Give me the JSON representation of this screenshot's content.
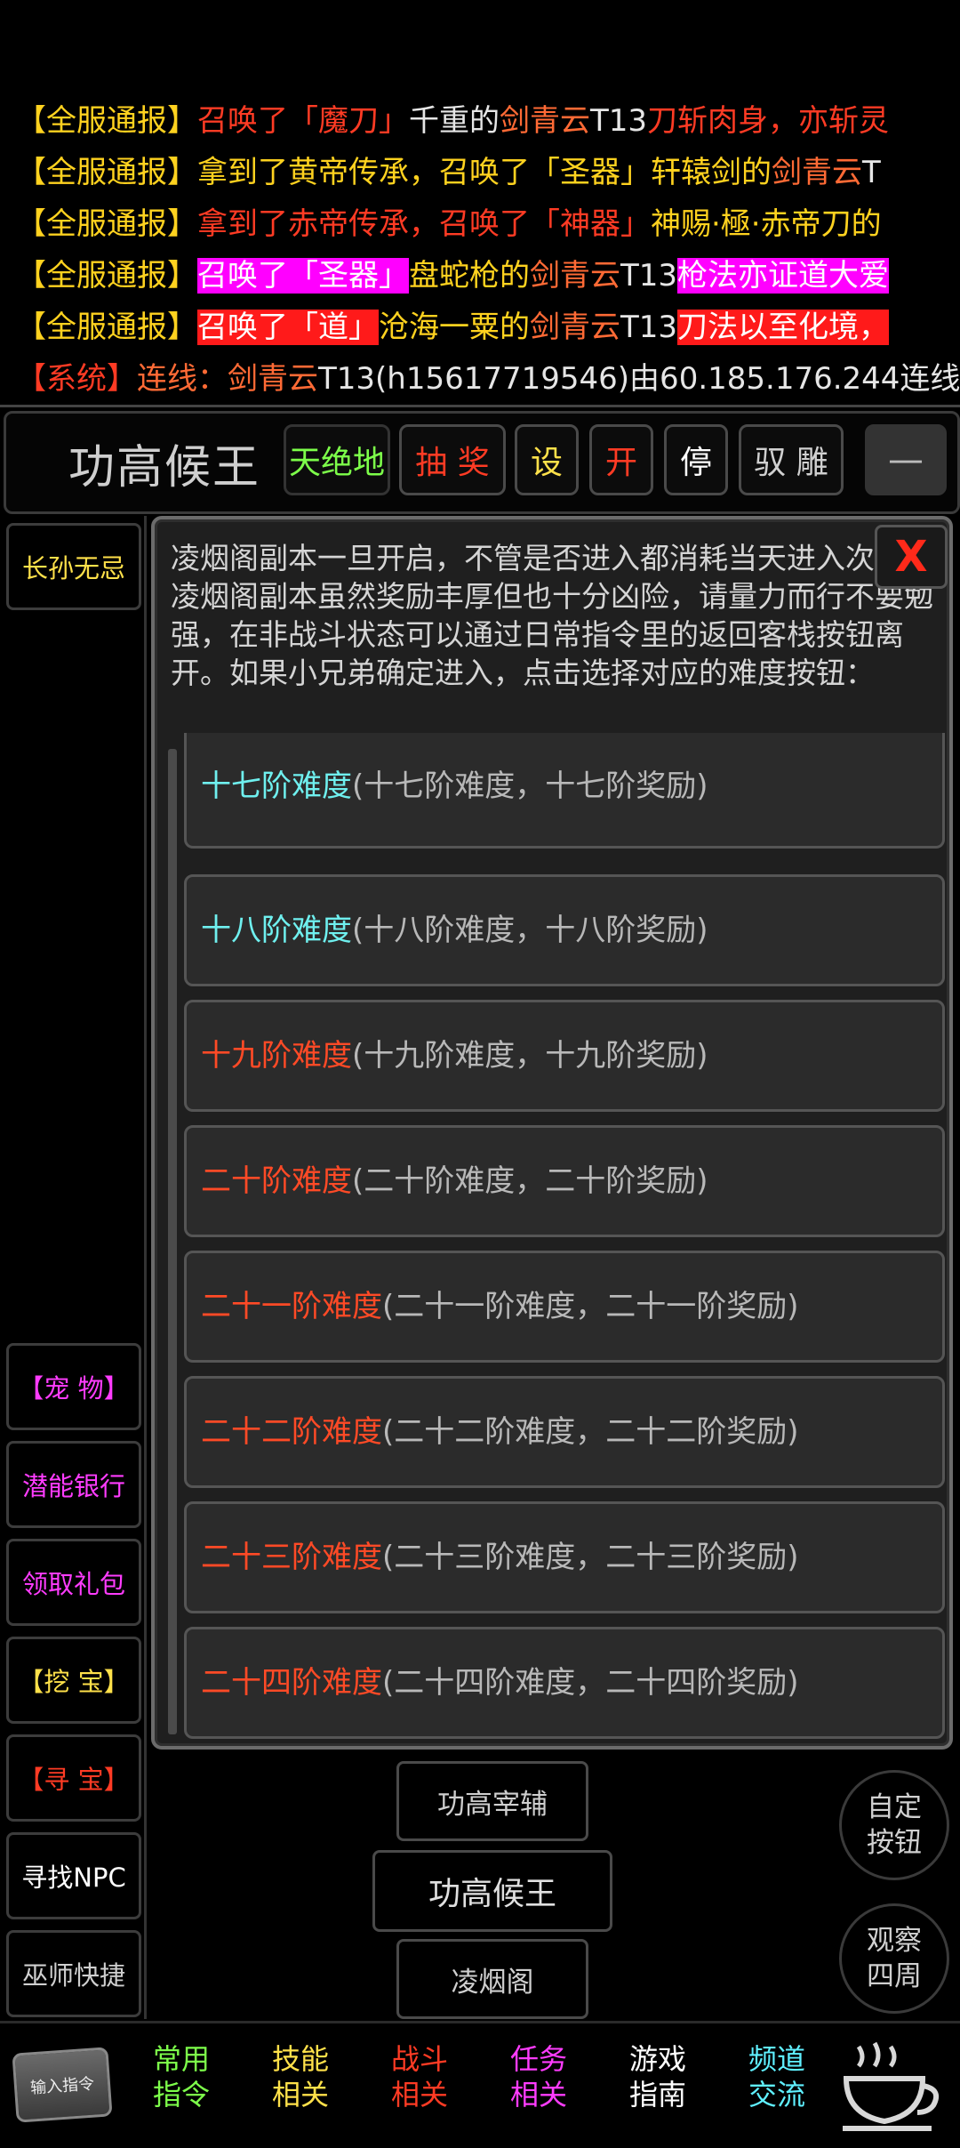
{
  "broadcast": [
    {
      "segments": [
        {
          "t": "【全服通报】",
          "c": "y"
        },
        {
          "t": "召唤了「魔刀」",
          "c": "r"
        },
        {
          "t": "千重",
          "c": "w"
        },
        {
          "t": "的",
          "c": "w"
        },
        {
          "t": "剑青云",
          "c": "o"
        },
        {
          "t": "T13",
          "c": "w"
        },
        {
          "t": "刀斩肉身，亦斩灵",
          "c": "r"
        }
      ]
    },
    {
      "segments": [
        {
          "t": "【全服通报】",
          "c": "y"
        },
        {
          "t": "拿到了黄帝传承，召唤了「圣器」轩辕剑的",
          "c": "y"
        },
        {
          "t": "剑青云",
          "c": "o"
        },
        {
          "t": "T",
          "c": "w"
        }
      ]
    },
    {
      "segments": [
        {
          "t": "【全服通报】",
          "c": "y"
        },
        {
          "t": "拿到了赤帝传承，召唤了「神器」",
          "c": "r"
        },
        {
          "t": "神赐·極·赤帝刀的",
          "c": "y"
        }
      ]
    },
    {
      "segments": [
        {
          "t": "【全服通报】",
          "c": "y"
        },
        {
          "t": "召唤了「圣器」",
          "c": "hl-mag"
        },
        {
          "t": "盘蛇枪的",
          "c": "y"
        },
        {
          "t": "剑青云",
          "c": "o"
        },
        {
          "t": "T13",
          "c": "w"
        },
        {
          "t": "枪法亦证道大爱",
          "c": "hl-mag"
        }
      ]
    },
    {
      "segments": [
        {
          "t": "【全服通报】",
          "c": "y"
        },
        {
          "t": "召唤了「道」",
          "c": "hl-red"
        },
        {
          "t": "沧海一粟的",
          "c": "y"
        },
        {
          "t": "剑青云",
          "c": "o"
        },
        {
          "t": "T13",
          "c": "w"
        },
        {
          "t": "刀法以至化境，",
          "c": "hl-red"
        }
      ]
    },
    {
      "segments": [
        {
          "t": "【系统】",
          "c": "r"
        },
        {
          "t": "连线：",
          "c": "o"
        },
        {
          "t": "剑青云",
          "c": "o"
        },
        {
          "t": "T13(h15617719546)由60.185.176.244连线",
          "c": "w"
        }
      ]
    }
  ],
  "topbar": {
    "room_name": "功高候王",
    "exits": "天绝地",
    "lottery": "抽 奖",
    "settings": "设",
    "open": "开",
    "stop": "停",
    "ride": "驭 雕",
    "minimize": "—"
  },
  "left_column": {
    "npc": "长孙无忌",
    "pet": "【宠 物】",
    "potential_bank": "潜能银行",
    "gift": "领取礼包",
    "dig": "【挖 宝】",
    "treasure": "【寻 宝】",
    "find_npc": "寻找NPC",
    "wizard": "巫师快捷"
  },
  "dialog": {
    "text": "凌烟阁副本一旦开启，不管是否进入都消耗当天进入次数。凌烟阁副本虽然奖励丰厚但也十分凶险，请量力而行不要勉强，在非战斗状态可以通过日常指令里的返回客栈按钮离开。如果小兄弟确定进入，点击选择对应的难度按钮：",
    "close": "X",
    "options": [
      {
        "name": "十七阶难度",
        "desc": "(十七阶难度，十七阶奖励)",
        "color": "#6ff0ef"
      },
      {
        "name": "十八阶难度",
        "desc": "(十八阶难度，十八阶奖励)",
        "color": "#6ff0ef"
      },
      {
        "name": "十九阶难度",
        "desc": "(十九阶难度，十九阶奖励)",
        "color": "#ff4a26"
      },
      {
        "name": "二十阶难度",
        "desc": "(二十阶难度，二十阶奖励)",
        "color": "#ff4a26"
      },
      {
        "name": "二十一阶难度",
        "desc": "(二十一阶难度，二十一阶奖励)",
        "color": "#ff4a26"
      },
      {
        "name": "二十二阶难度",
        "desc": "(二十二阶难度，二十二阶奖励)",
        "color": "#ff4a26"
      },
      {
        "name": "二十三阶难度",
        "desc": "(二十三阶难度，二十三阶奖励)",
        "color": "#ff4a26"
      },
      {
        "name": "二十四阶难度",
        "desc": "(二十四阶难度，二十四阶奖励)",
        "color": "#ff4a26"
      }
    ]
  },
  "actions": {
    "north": "功高宰辅",
    "center": "功高候王",
    "south": "凌烟阁",
    "custom": "自定\n按钮",
    "observe": "观察\n四周"
  },
  "bottom_nav": {
    "input_cmd": "输入指令",
    "items": [
      {
        "label": "常用\n指令",
        "color": "#7dff4a"
      },
      {
        "label": "技能\n相关",
        "color": "#ffe14a"
      },
      {
        "label": "战斗\n相关",
        "color": "#ff3b24"
      },
      {
        "label": "任务\n相关",
        "color": "#ff3cff"
      },
      {
        "label": "游戏\n指南",
        "color": "#ffffff"
      },
      {
        "label": "频道\n交流",
        "color": "#5ff0ff"
      }
    ],
    "teacup_icon": "teacup-icon"
  }
}
